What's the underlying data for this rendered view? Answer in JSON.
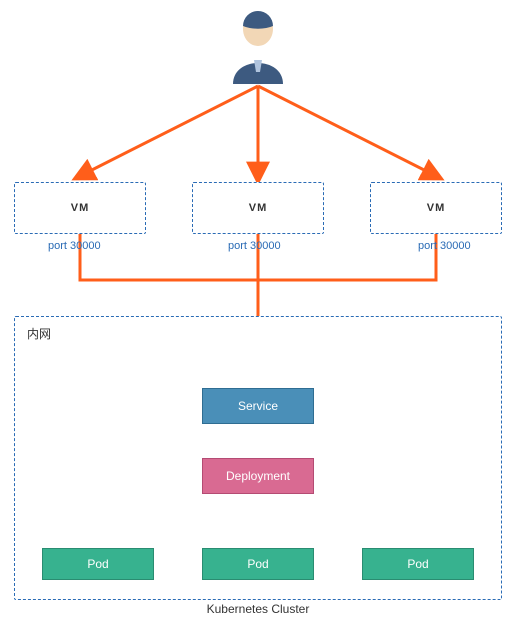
{
  "user": {
    "label": "User",
    "icon": "user-icon"
  },
  "vms": [
    {
      "label": "VM",
      "port": "port 30000"
    },
    {
      "label": "VM",
      "port": "port 30000"
    },
    {
      "label": "VM",
      "port": "port 30000"
    }
  ],
  "cluster": {
    "inner_label": "内网",
    "outer_label": "Kubernetes Cluster"
  },
  "service": {
    "label": "Service"
  },
  "deployment": {
    "label": "Deployment"
  },
  "pods": [
    {
      "label": "Pod"
    },
    {
      "label": "Pod"
    },
    {
      "label": "Pod"
    }
  ],
  "colors": {
    "arrow": "#ff5e1a",
    "dash": "#2a6bb5",
    "service": "#4a8fb8",
    "deployment": "#d96a92",
    "pod": "#37b28f"
  }
}
